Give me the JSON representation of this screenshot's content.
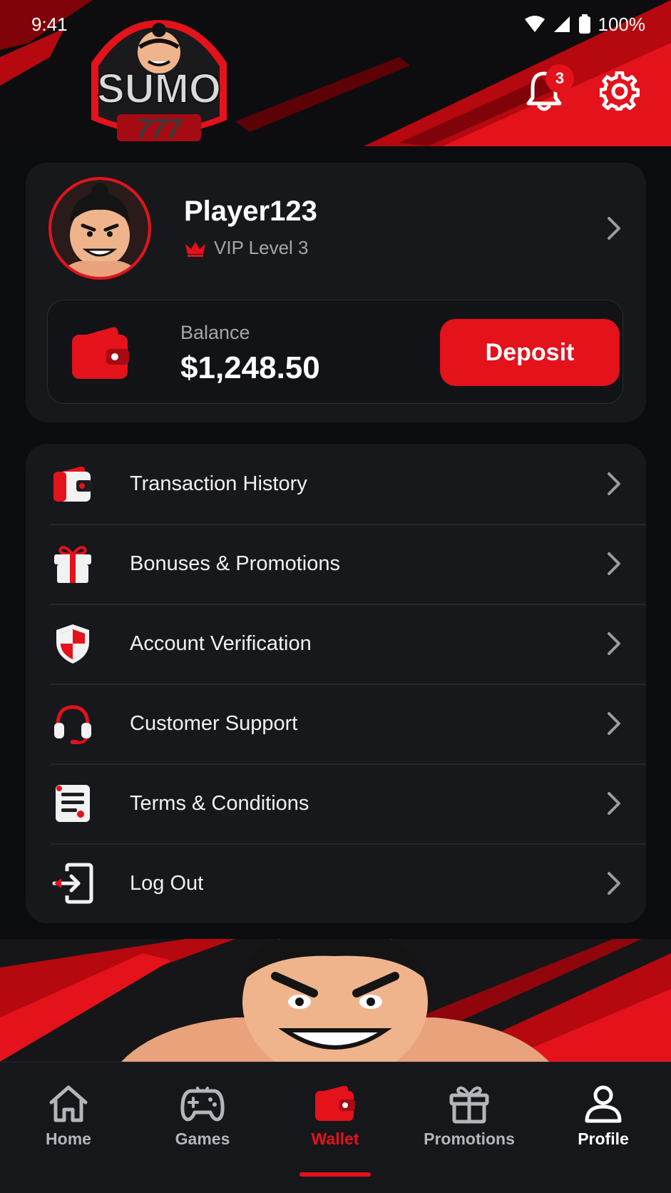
{
  "status_bar": {
    "time": "9:41",
    "battery": "100%"
  },
  "header": {
    "logo_text": "SUMO",
    "logo_number": "777",
    "notifications_count": "3"
  },
  "profile": {
    "username": "Player123",
    "vip_level": "VIP Level 3"
  },
  "balance": {
    "label": "Balance",
    "amount": "$1,248.50",
    "deposit_label": "Deposit"
  },
  "menu": {
    "items": [
      {
        "label": "Transaction History",
        "icon": "wallet-icon"
      },
      {
        "label": "Bonuses & Promotions",
        "icon": "gift-icon"
      },
      {
        "label": "Account Verification",
        "icon": "shield-icon"
      },
      {
        "label": "Customer Support",
        "icon": "headset-icon"
      },
      {
        "label": "Terms & Conditions",
        "icon": "document-icon"
      },
      {
        "label": "Log Out",
        "icon": "logout-icon"
      }
    ]
  },
  "bottom_nav": {
    "items": [
      {
        "label": "Home",
        "icon": "home-icon"
      },
      {
        "label": "Games",
        "icon": "gamepad-icon"
      },
      {
        "label": "Wallet",
        "icon": "wallet-icon"
      },
      {
        "label": "Promotions",
        "icon": "gift-icon"
      },
      {
        "label": "Profile",
        "icon": "user-icon"
      }
    ],
    "active": "Wallet"
  },
  "colors": {
    "accent": "#e3121b",
    "background": "#0b0c0f",
    "card": "#17181c",
    "muted_text": "#a4a6ab"
  }
}
